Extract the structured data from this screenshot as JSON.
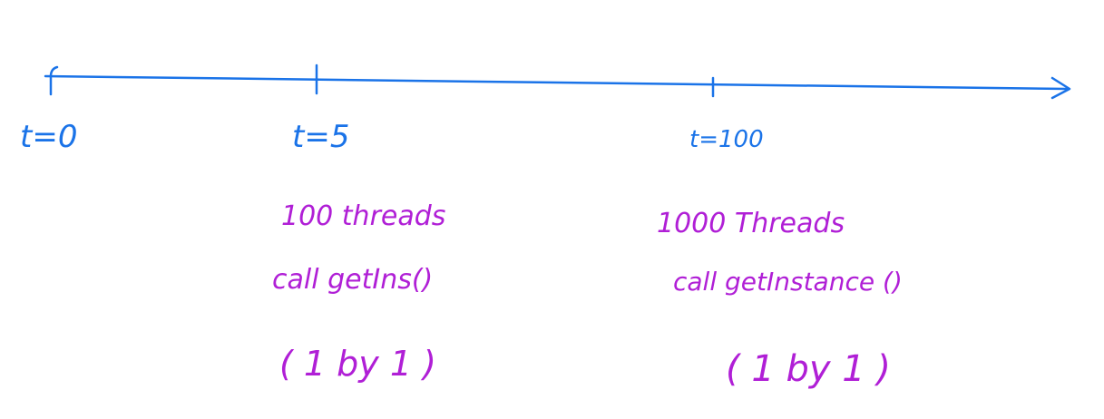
{
  "colors": {
    "timeline": "#1a73e8",
    "notes": "#b01fd6"
  },
  "timeline": {
    "ticks": [
      {
        "label": "t=0"
      },
      {
        "label": "t=5"
      },
      {
        "label": "t=100"
      }
    ]
  },
  "notes": {
    "t5": {
      "line1": "100 threads",
      "line2": "call getIns()",
      "line3": "( 1 by 1 )"
    },
    "t100": {
      "line1": "1000 Threads",
      "line2": "call getInstance ()",
      "line3": "( 1 by 1 )"
    }
  }
}
